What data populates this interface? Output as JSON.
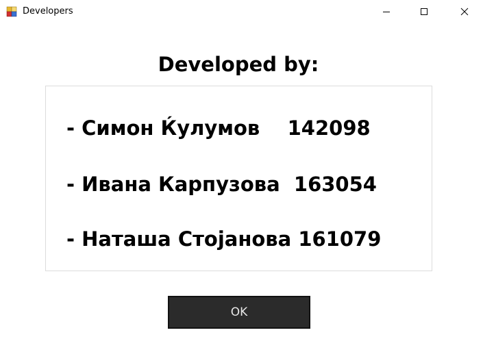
{
  "window": {
    "title": "Developers",
    "controls": {
      "minimize_icon": "minimize-icon",
      "maximize_icon": "maximize-icon",
      "close_icon": "close-icon"
    }
  },
  "content": {
    "heading": "Developed by:",
    "developers": [
      "- Симон Ќулумов    142098",
      "- Ивана Карпузова  163054",
      "- Наташа Стојанова 161079"
    ]
  },
  "buttons": {
    "ok_label": "OK"
  },
  "colors": {
    "button_background": "#2b2b2b",
    "button_text": "#e8e8e8",
    "panel_border": "#dcdcdc"
  }
}
